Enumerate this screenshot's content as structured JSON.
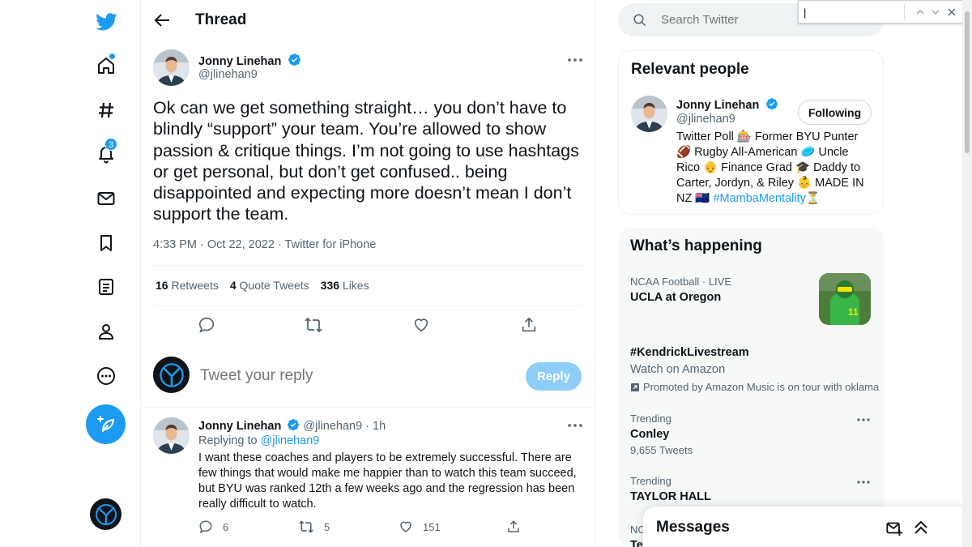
{
  "colors": {
    "accent": "#1d9bf0",
    "text": "#0f1419",
    "muted": "#536471",
    "reply_disabled": "#8ecdf8"
  },
  "nav": {
    "items": [
      {
        "icon": "twitter-logo-icon"
      },
      {
        "icon": "home-icon"
      },
      {
        "icon": "explore-hashtag-icon"
      },
      {
        "icon": "notifications-bell-icon",
        "badge": "3"
      },
      {
        "icon": "messages-envelope-icon"
      },
      {
        "icon": "bookmarks-icon"
      },
      {
        "icon": "lists-icon"
      },
      {
        "icon": "profile-icon"
      },
      {
        "icon": "more-circle-icon"
      }
    ],
    "compose_icon": "compose-feather-icon"
  },
  "header": {
    "title": "Thread"
  },
  "tweet": {
    "author_name": "Jonny Linehan",
    "author_handle": "@jlinehan9",
    "text": "Ok can we get something straight… you don’t have to blindly “support” your team. You’re allowed to show passion & critique things. I’m not going to use hashtags or get personal, but don’t get confused.. being disappointed and expecting more doesn’t mean I don’t support the team.",
    "timestamp": "4:33 PM · Oct 22, 2022 · Twitter for iPhone",
    "retweets_count": "16",
    "retweets_label": "Retweets",
    "quotes_count": "4",
    "quotes_label": "Quote Tweets",
    "likes_count": "336",
    "likes_label": "Likes"
  },
  "reply_composer": {
    "placeholder": "Tweet your reply",
    "button_label": "Reply"
  },
  "reply": {
    "author_name": "Jonny Linehan",
    "author_handle": "@jlinehan9",
    "time": "· 1h",
    "replying_prefix": "Replying to",
    "replying_to": "@jlinehan9",
    "text": "I want these coaches and players to be extremely successful. There are few things that would make me happier than to watch this team succeed, but BYU was ranked 12th a few weeks ago and the regression has been really difficult to watch.",
    "reply_count": "6",
    "retweet_count": "5",
    "like_count": "151"
  },
  "search": {
    "placeholder": "Search Twitter",
    "find_value": "|"
  },
  "relevant_people": {
    "title": "Relevant people",
    "name": "Jonny Linehan",
    "handle": "@jlinehan9",
    "follow_label": "Following",
    "bio": "Twitter Poll 🎰 Former BYU Punter 🏈 Rugby All-American 🥏 Uncle Rico 👴 Finance Grad 🎓 Daddy to Carter, Jordyn, & Riley 👶 MADE IN NZ 🇳🇿",
    "bio_hashtag": "#MambaMentality⏳"
  },
  "happening": {
    "title": "What’s happening",
    "trends": [
      {
        "category": "NCAA Football · LIVE",
        "title": "UCLA at Oregon"
      },
      {
        "title": "#KendrickLivestream",
        "subtitle": "Watch on Amazon",
        "promoted": "Promoted by Amazon Music is on tour with oklama"
      },
      {
        "category": "Trending",
        "title": "Conley",
        "subtitle": "9,655 Tweets"
      },
      {
        "category": "Trending",
        "title": "TAYLOR HALL"
      },
      {
        "category": "NC",
        "title": "Te"
      }
    ]
  },
  "messages": {
    "title": "Messages"
  }
}
